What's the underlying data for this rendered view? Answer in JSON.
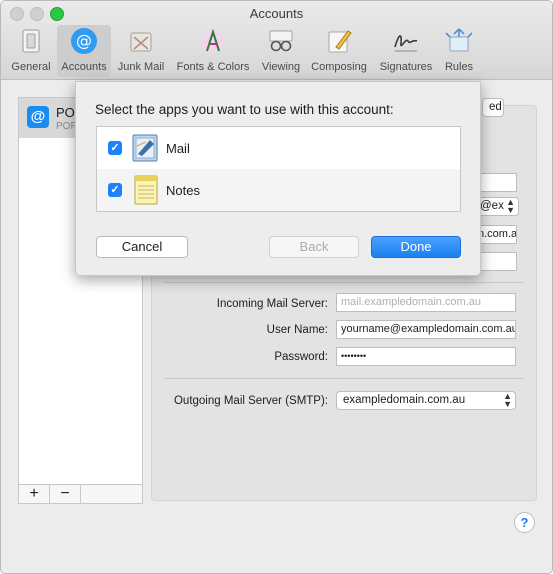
{
  "window": {
    "title": "Accounts"
  },
  "toolbar": {
    "items": [
      {
        "label": "General",
        "icon": "general-switch-icon"
      },
      {
        "label": "Accounts",
        "icon": "at-sign-icon",
        "selected": true
      },
      {
        "label": "Junk Mail",
        "icon": "junk-mail-icon"
      },
      {
        "label": "Fonts & Colors",
        "icon": "fonts-colors-icon"
      },
      {
        "label": "Viewing",
        "icon": "glasses-icon"
      },
      {
        "label": "Composing",
        "icon": "pencil-icon"
      },
      {
        "label": "Signatures",
        "icon": "signature-icon"
      },
      {
        "label": "Rules",
        "icon": "rules-icon"
      }
    ]
  },
  "sidebar": {
    "account_name": "PO",
    "account_sub": "POP",
    "add_label": "+",
    "remove_label": "−"
  },
  "panel": {
    "tab_partial": "ed",
    "email_partial": "@ex",
    "field_partial": "n.com.a",
    "incoming_label": "Incoming Mail Server:",
    "incoming_placeholder": "mail.exampledomain.com.au",
    "username_label": "User Name:",
    "username_value": "yourname@exampledomain.com.au",
    "password_label": "Password:",
    "password_value": "••••••••",
    "smtp_label": "Outgoing Mail Server (SMTP):",
    "smtp_value": "exampledomain.com.au"
  },
  "sheet": {
    "title": "Select the apps you want to use with this account:",
    "apps": [
      {
        "label": "Mail",
        "checked": true,
        "icon": "mail-app-icon"
      },
      {
        "label": "Notes",
        "checked": true,
        "icon": "notes-app-icon"
      }
    ],
    "cancel_label": "Cancel",
    "back_label": "Back",
    "done_label": "Done"
  },
  "help": {
    "label": "?"
  },
  "colors": {
    "accent": "#1a82fb",
    "zoom": "#2ac845"
  }
}
